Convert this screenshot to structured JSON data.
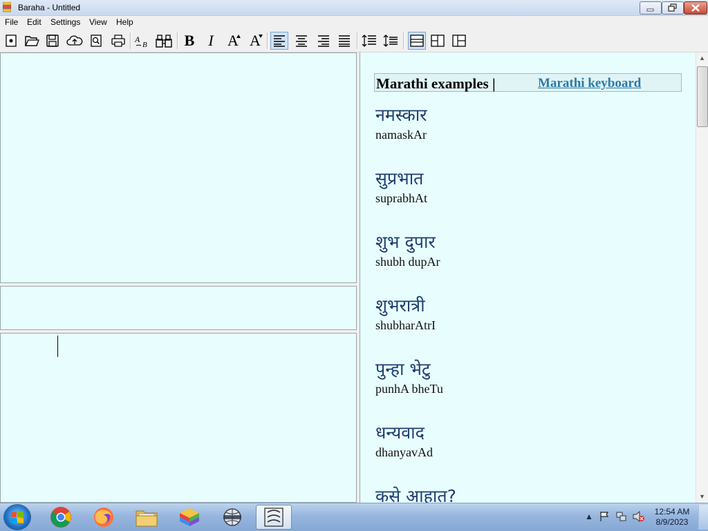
{
  "window": {
    "title": "Baraha - Untitled"
  },
  "menu": [
    "File",
    "Edit",
    "Settings",
    "View",
    "Help"
  ],
  "toolbar": {
    "bold": "B",
    "italic": "I",
    "increase_font": "A",
    "decrease_font": "A"
  },
  "examples": {
    "title": "Marathi examples |",
    "link": "Marathi keyboard",
    "items": [
      {
        "native": "नमस्कार",
        "roman": "namaskAr"
      },
      {
        "native": "सुप्रभात",
        "roman": "suprabhAt"
      },
      {
        "native": "शुभ  दुपार",
        "roman": "shubh dupAr"
      },
      {
        "native": "शुभरात्री",
        "roman": "shubharAtrI"
      },
      {
        "native": "पुन्हा  भेटु",
        "roman": "punhA bheTu"
      },
      {
        "native": "धन्यवाद",
        "roman": "dhanyavAd"
      },
      {
        "native": "कसे  आहात?",
        "roman": ""
      }
    ]
  },
  "taskbar": {
    "time": "12:54 AM",
    "date": "8/9/2023"
  }
}
